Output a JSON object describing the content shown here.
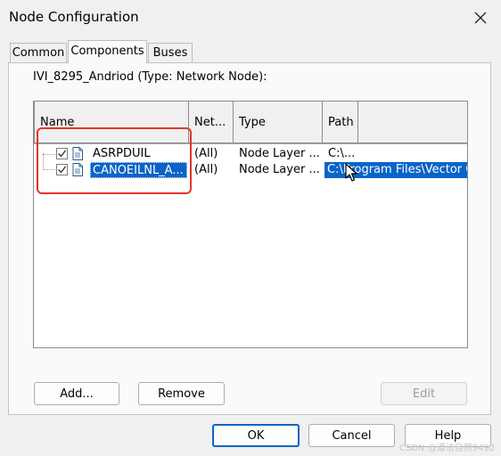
{
  "window": {
    "title": "Node Configuration",
    "close_icon": "close-icon"
  },
  "tabs": [
    {
      "label": "Common",
      "active": false
    },
    {
      "label": "Components",
      "active": true
    },
    {
      "label": "Buses",
      "active": false
    }
  ],
  "node": {
    "title": "IVI_8295_Andriod (Type: Network Node):"
  },
  "components_list": {
    "columns": [
      "Name",
      "Net...",
      "Type",
      "Path"
    ],
    "rows": [
      {
        "name": "ASRPDUIL",
        "net": "(All)",
        "type": "Node Layer ...",
        "path": "C:\\...",
        "checked": true,
        "selected": false
      },
      {
        "name": "CANOEILNL_A...",
        "net": "(All)",
        "type": "Node Layer ...",
        "path": "C:\\Program Files\\Vector CANoe",
        "checked": true,
        "selected": true
      }
    ]
  },
  "buttons": {
    "add": "Add...",
    "remove": "Remove",
    "edit": "Edit",
    "ok": "OK",
    "cancel": "Cancel",
    "help": "Help"
  },
  "watermark": "CSDN @道法自然9492",
  "colors": {
    "selection": "#0a64c8",
    "highlight_box": "#e8322b",
    "default_button_border": "#0b63c7"
  }
}
